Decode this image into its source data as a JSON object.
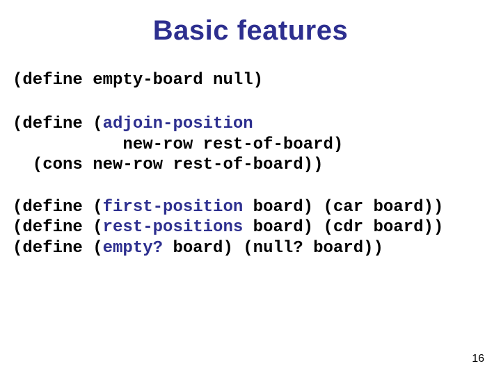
{
  "title": "Basic features",
  "page_number": "16",
  "code": {
    "b1": "(define empty-board null)",
    "b2_l1a": "(define (",
    "b2_l1_fn": "adjoin-position",
    "b2_l2": "           new-row rest-of-board)",
    "b2_l3": "  (cons new-row rest-of-board))",
    "b3_l1a": "(define (",
    "b3_l1_fn": "first-position",
    "b3_l1b": " board) (car board))",
    "b3_l2a": "(define (",
    "b3_l2_fn": "rest-positions",
    "b3_l2b": " board) (cdr board))",
    "b3_l3a": "(define (",
    "b3_l3_fn": "empty?",
    "b3_l3b": " board) (null? board))"
  }
}
